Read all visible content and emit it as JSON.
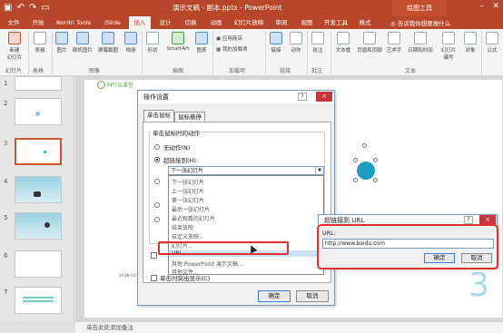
{
  "app": {
    "title": "演示文稿 - 副本.pptx - PowerPoint",
    "context_tool_group": "绘图工具"
  },
  "tabs": [
    {
      "label": "文件"
    },
    {
      "label": "开始"
    },
    {
      "label": "Nordri Tools"
    },
    {
      "label": "iSlide"
    },
    {
      "label": "插入"
    },
    {
      "label": "设计"
    },
    {
      "label": "切换"
    },
    {
      "label": "动画"
    },
    {
      "label": "幻灯片放映"
    },
    {
      "label": "审阅"
    },
    {
      "label": "视图"
    },
    {
      "label": "开发工具"
    },
    {
      "label": "格式"
    }
  ],
  "active_tab": "插入",
  "tell_me": "告诉我你想要做什么",
  "ribbon": {
    "new_slide": "新建\n幻灯片",
    "table": "表格",
    "image": "图片",
    "online_image": "联机图片",
    "screenshot": "屏幕截图",
    "album": "相册",
    "shapes": "形状",
    "smartart": "SmartArt",
    "chart": "图表",
    "store": "应用商店",
    "my_addins": "我的加载项",
    "link": "链接",
    "action": "动作",
    "comment": "批注",
    "textbox": "文本框",
    "header_footer": "页眉和页脚",
    "wordart": "艺术字",
    "datetime": "日期和时间",
    "slide_number": "幻灯片\n编号",
    "object": "对象",
    "equation": "公式",
    "groups": {
      "slides": "幻灯片",
      "tables": "表格",
      "images": "图像",
      "illustrations": "插图",
      "addins": "加载项",
      "links": "链接",
      "comments": "批注",
      "text": "文本"
    }
  },
  "thumbnails": [
    {
      "num": "1"
    },
    {
      "num": "2"
    },
    {
      "num": "3"
    },
    {
      "num": "4"
    },
    {
      "num": "5"
    },
    {
      "num": "6"
    },
    {
      "num": "7"
    }
  ],
  "slide": {
    "logo_text": "PPT云课堂",
    "big_number": "3",
    "date": "2018-01-04"
  },
  "notes_placeholder": "单击此处添加备注",
  "action_dialog": {
    "title": "操作设置",
    "help": "?",
    "close": "×",
    "tab_click": "单击鼠标",
    "tab_hover": "鼠标悬停",
    "group_label": "单击鼠标时的动作",
    "radio_none": "无动作(N)",
    "radio_hyperlink": "超链接到(H):",
    "combo_value": "下一张幻灯片",
    "dropdown_items": [
      "下一张幻灯片",
      "上一张幻灯片",
      "第一张幻灯片",
      "最后一张幻灯片",
      "最近观看的幻灯片",
      "结束放映",
      "自定义放映...",
      "幻灯片...",
      "URL...",
      "其他 PowerPoint 演示文稿...",
      "其他文件..."
    ],
    "selected_item": "URL...",
    "chk_highlight": "单击时突出显示(C)",
    "ok": "确定",
    "cancel": "取消"
  },
  "url_dialog": {
    "title": "超链接到 URL",
    "help": "?",
    "close": "×",
    "label": "URL:",
    "value": "http://www.baidu.com",
    "ok": "确定",
    "cancel": "取消"
  },
  "colors": {
    "accent": "#b7472a",
    "highlight_box": "#e03030",
    "selection": "#cfe2f7"
  }
}
